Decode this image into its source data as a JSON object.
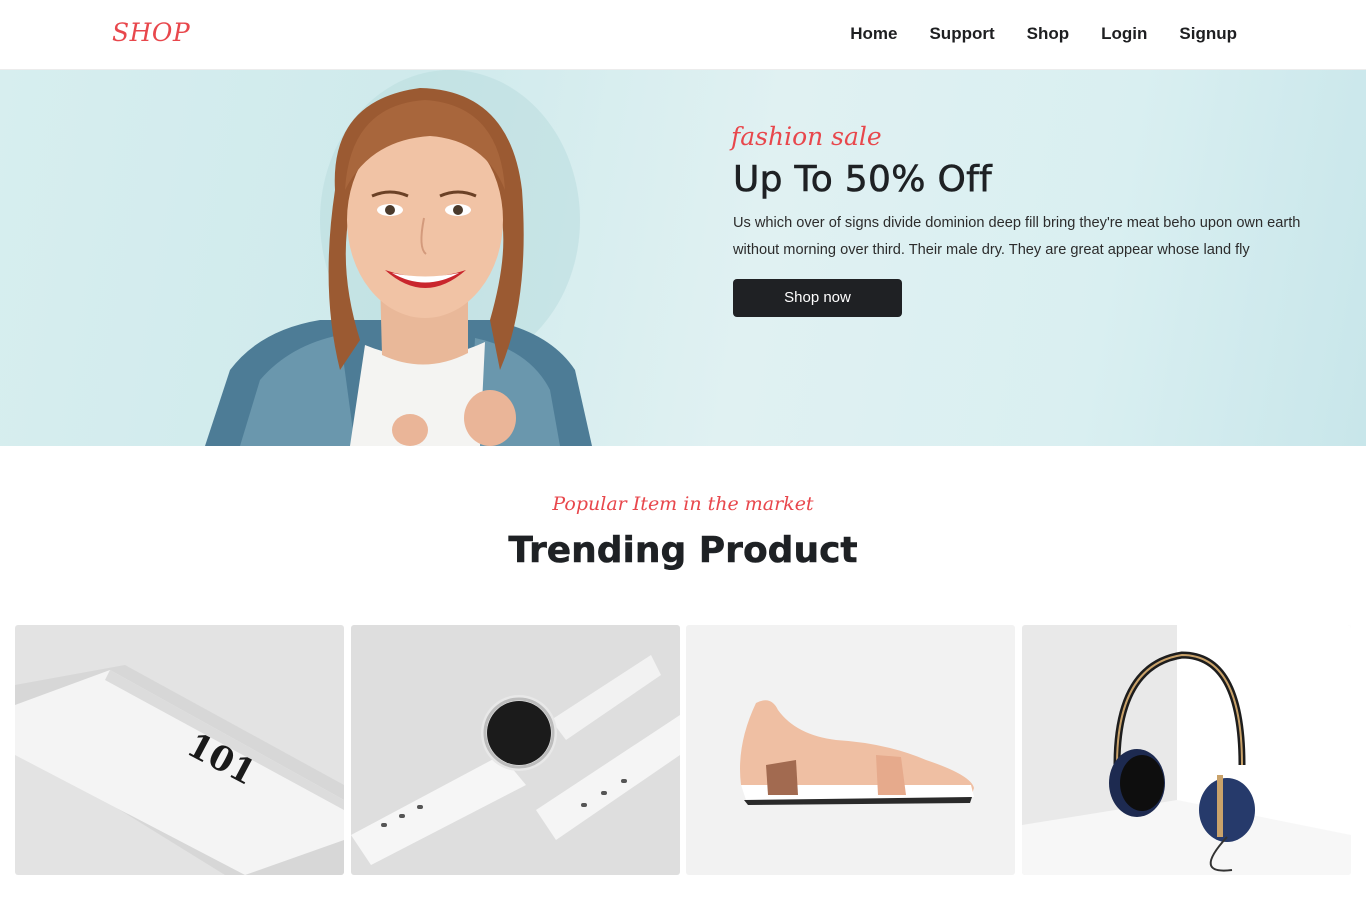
{
  "header": {
    "logo": "SHOP",
    "nav": [
      "Home",
      "Support",
      "Shop",
      "Login",
      "Signup"
    ]
  },
  "hero": {
    "kicker": "fashion sale",
    "title": "Up To 50% Off",
    "description": "Us which over of signs divide dominion deep fill bring they're meat beho upon own earth without morning over third. Their male dry. They are great appear whose land fly",
    "button": "Shop now"
  },
  "section": {
    "kicker": "Popular Item in the market",
    "title": "Trending Product"
  },
  "products": [
    {
      "icon": "cosmetic-tube-product-image",
      "tube_print": "101"
    },
    {
      "icon": "smart-watch-product-image"
    },
    {
      "icon": "sneaker-product-image"
    },
    {
      "icon": "headphones-product-image"
    }
  ],
  "colors": {
    "accent": "#e8474c",
    "dark": "#1f2124",
    "hero_bg": "#d7eeef"
  }
}
